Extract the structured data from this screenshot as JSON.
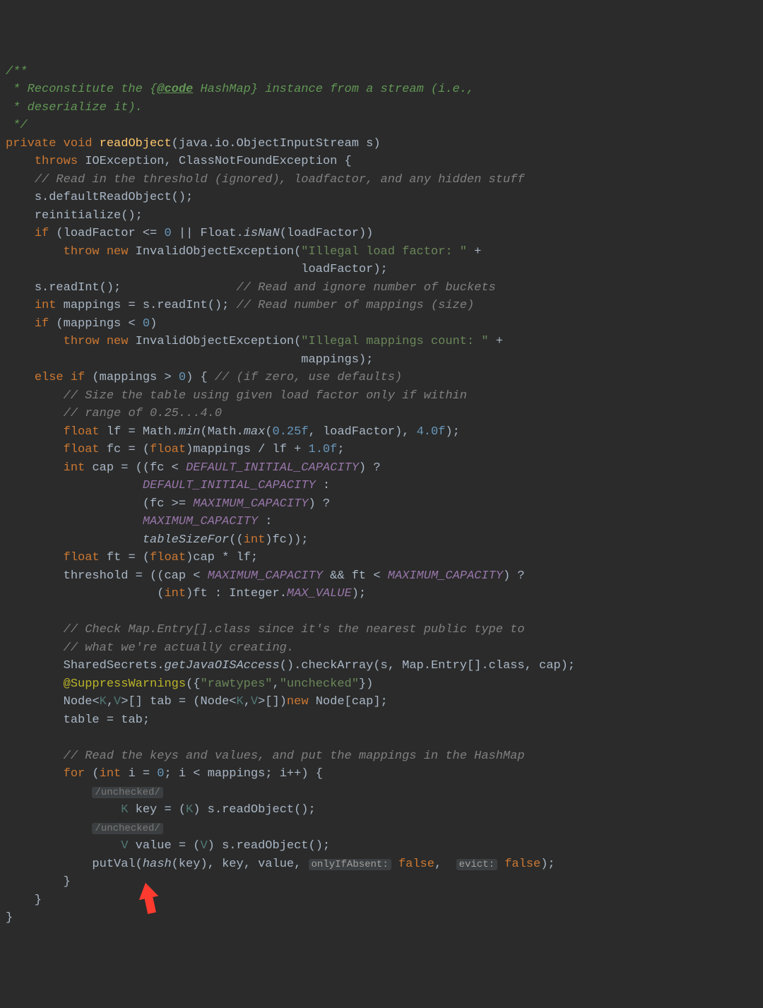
{
  "doc": {
    "l1": "/**",
    "l2": " * Reconstitute the {",
    "tag": "@code",
    "l2b": " HashMap} instance from a stream (i.e.,",
    "l3": " * deserialize it).",
    "l4": " */"
  },
  "kw": {
    "private": "private",
    "void": "void",
    "throws": "throws",
    "if": "if",
    "throw": "throw",
    "new": "new",
    "int": "int",
    "else": "else",
    "float": "float",
    "for": "for",
    "false": "false"
  },
  "sym": {
    "readObject": "readObject",
    "ObjectInputStream": "java.io.ObjectInputStream s",
    "IOException": "IOException",
    "CNFE": "ClassNotFoundException",
    "InvalidObjectException": "InvalidObjectException",
    "Float": "Float",
    "isNaN": "isNaN",
    "Math": "Math",
    "min": "min",
    "max": "max",
    "tableSizeFor": "tableSizeFor",
    "Integer": "Integer",
    "MAX_VALUE": "MAX_VALUE",
    "SharedSecrets": "SharedSecrets",
    "getJavaOISAccess": "getJavaOISAccess",
    "checkArray": "checkArray",
    "Map": "Map",
    "Entry": "Entry",
    "Node": "Node",
    "SuppressWarnings": "@SuppressWarnings",
    "hash": "hash",
    "putVal": "putVal",
    "readObj": "readObject",
    "readInt": "readInt",
    "defaultReadObject": "defaultReadObject",
    "reinitialize": "reinitialize"
  },
  "vars": {
    "loadFactor": "loadFactor",
    "mappings": "mappings",
    "lf": "lf",
    "fc": "fc",
    "cap": "cap",
    "ft": "ft",
    "threshold": "threshold",
    "tab": "tab",
    "table": "table",
    "i": "i",
    "key": "key",
    "value": "value",
    "s": "s",
    "K": "K",
    "V": "V"
  },
  "consts": {
    "DIC": "DEFAULT_INITIAL_CAPACITY",
    "MC": "MAXIMUM_CAPACITY"
  },
  "strs": {
    "illegalLoad": "\"Illegal load factor: \"",
    "illegalMap": "\"Illegal mappings count: \"",
    "rawtypes": "\"rawtypes\"",
    "unchecked": "\"unchecked\""
  },
  "nums": {
    "zero": "0",
    "p25": "0.25f",
    "four": "4.0f",
    "one": "1.0f"
  },
  "cmts": {
    "c1": "// Read in the threshold (ignored), loadfactor, and any hidden stuff",
    "c2": "// Read and ignore number of buckets",
    "c3": "// Read number of mappings (size)",
    "c4": "// (if zero, use defaults)",
    "c5": "// Size the table using given load factor only if within",
    "c6": "// range of 0.25...4.0",
    "c7": "// Check Map.Entry[].class since it's the nearest public type to",
    "c8": "// what we're actually creating.",
    "c9": "// Read the keys and values, and put the mappings in the HashMap"
  },
  "hints": {
    "unchecked": "/unchecked/",
    "onlyIfAbsent": "onlyIfAbsent:",
    "evict": "evict:"
  },
  "arrow": {
    "glyph": "➜"
  }
}
